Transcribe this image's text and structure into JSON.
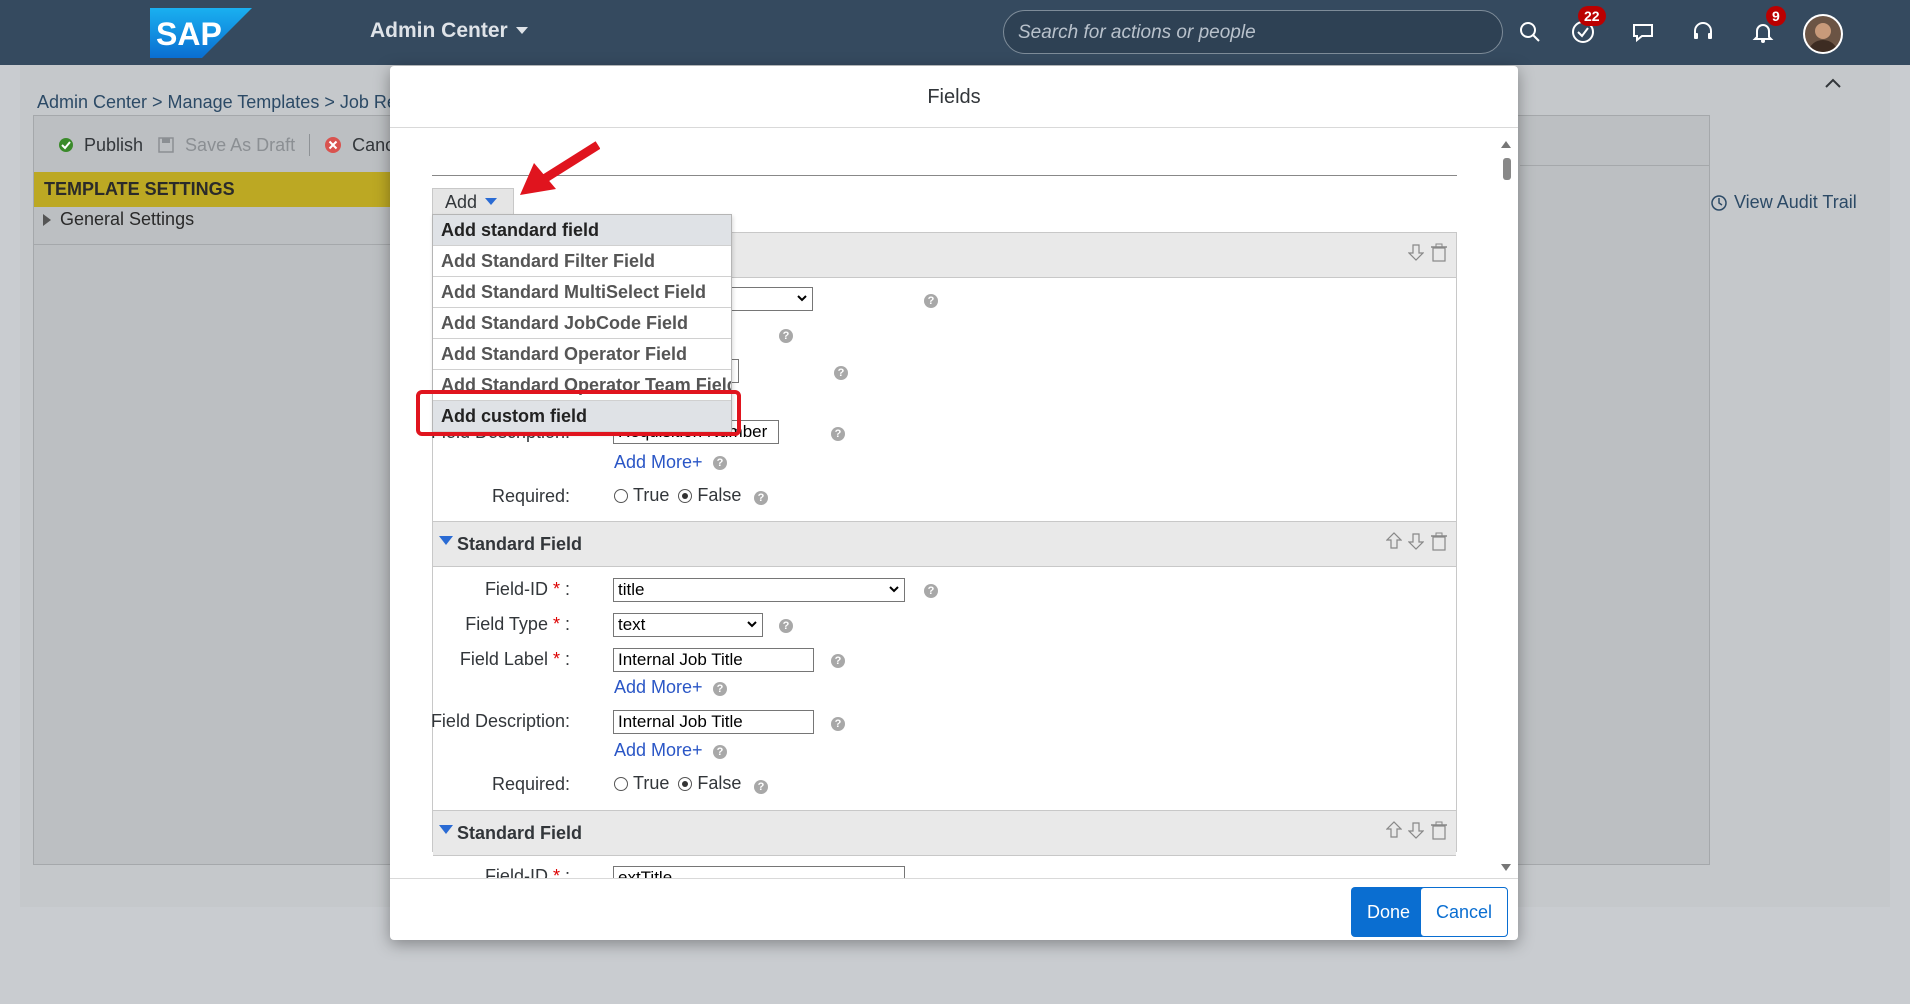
{
  "shell": {
    "logo_text": "SAP",
    "app_title": "Admin Center",
    "search_placeholder": "Search for actions or people",
    "todo_badge": "22",
    "notif_badge": "9"
  },
  "page": {
    "breadcrumb": "Admin Center > Manage Templates > Job Req",
    "toolbar": {
      "publish": "Publish",
      "save_draft": "Save As Draft",
      "cancel": "Canc"
    },
    "template_settings": "TEMPLATE SETTINGS",
    "general_settings": "General Settings",
    "view_audit_trail": "View Audit Trail"
  },
  "dialog": {
    "title": "Fields",
    "add_button": "Add",
    "menu_items": [
      "Add standard field",
      "Add Standard Filter Field",
      "Add Standard MultiSelect Field",
      "Add Standard JobCode Field",
      "Add Standard Operator Field",
      "Add Standard Operator Team Field",
      "Add custom field"
    ],
    "section1": {
      "field_description_label": "Field Description:",
      "field_description_value": "Requisition Number",
      "add_more": "Add More+",
      "required_label": "Required:",
      "true_label": "True",
      "false_label": "False"
    },
    "section2": {
      "title": "Standard Field",
      "field_id_label": "Field-ID",
      "field_id_value": "title",
      "field_type_label": "Field Type",
      "field_type_value": "text",
      "field_label_label": "Field Label",
      "field_label_value": "Internal Job Title",
      "add_more_1": "Add More+",
      "field_description_label": "Field Description:",
      "field_description_value": "Internal Job Title",
      "add_more_2": "Add More+",
      "required_label": "Required:",
      "true_label": "True",
      "false_label": "False"
    },
    "section3": {
      "title": "Standard Field",
      "field_id_label": "Field-ID",
      "field_id_value": "extTitle"
    },
    "done": "Done",
    "cancel": "Cancel"
  },
  "colors": {
    "shell_bg": "#354a5f",
    "accent": "#0a6ed1",
    "highlight": "#e0141e",
    "template_bar": "#bca823"
  }
}
